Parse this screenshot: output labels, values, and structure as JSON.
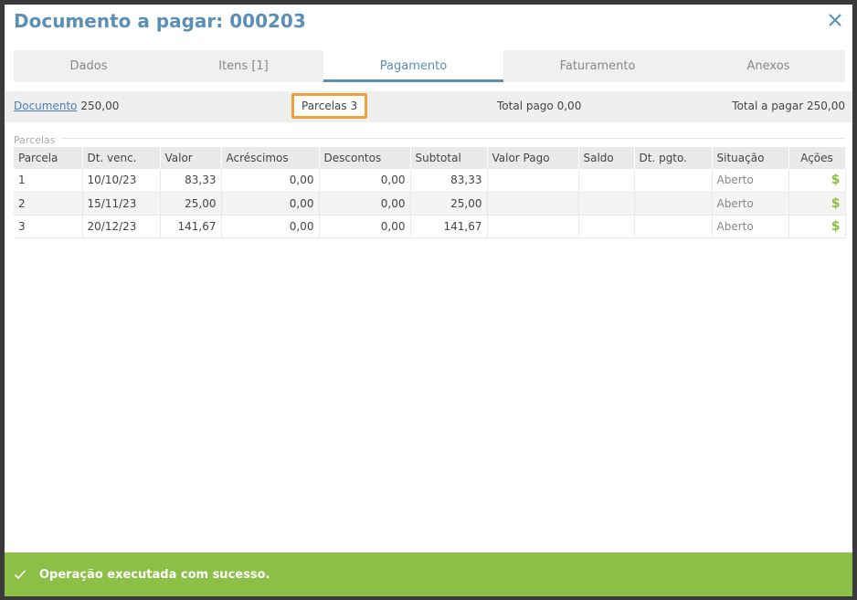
{
  "dialog": {
    "title": "Documento a pagar: 000203"
  },
  "tabs": [
    {
      "label": "Dados"
    },
    {
      "label": "Itens [1]"
    },
    {
      "label": "Pagamento"
    },
    {
      "label": "Faturamento"
    },
    {
      "label": "Anexos"
    }
  ],
  "summary": {
    "documento_label": "Documento",
    "documento_value": "250,00",
    "parcelas_label": "Parcelas",
    "parcelas_value": "3",
    "total_pago_label": "Total pago",
    "total_pago_value": "0,00",
    "total_pagar_label": "Total a pagar",
    "total_pagar_value": "250,00"
  },
  "parcelas": {
    "section_label": "Parcelas",
    "columns": [
      "Parcela",
      "Dt. venc.",
      "Valor",
      "Acréscimos",
      "Descontos",
      "Subtotal",
      "Valor Pago",
      "Saldo",
      "Dt. pgto.",
      "Situação",
      "Ações"
    ],
    "rows": [
      {
        "parcela": "1",
        "venc": "10/10/23",
        "valor": "83,33",
        "acrescimos": "0,00",
        "descontos": "0,00",
        "subtotal": "83,33",
        "pago": "",
        "saldo": "",
        "pgto": "",
        "situacao": "Aberto",
        "acao": "$"
      },
      {
        "parcela": "2",
        "venc": "15/11/23",
        "valor": "25,00",
        "acrescimos": "0,00",
        "descontos": "0,00",
        "subtotal": "25,00",
        "pago": "",
        "saldo": "",
        "pgto": "",
        "situacao": "Aberto",
        "acao": "$"
      },
      {
        "parcela": "3",
        "venc": "20/12/23",
        "valor": "141,67",
        "acrescimos": "0,00",
        "descontos": "0,00",
        "subtotal": "141,67",
        "pago": "",
        "saldo": "",
        "pgto": "",
        "situacao": "Aberto",
        "acao": "$"
      }
    ]
  },
  "toast": {
    "message": "Operação executada com sucesso.",
    "icon": "check-icon"
  },
  "colors": {
    "title": "#5b8fb5",
    "highlight_border": "#f0a03a",
    "success": "#8cbf45",
    "pay_icon": "#8dc03f"
  }
}
